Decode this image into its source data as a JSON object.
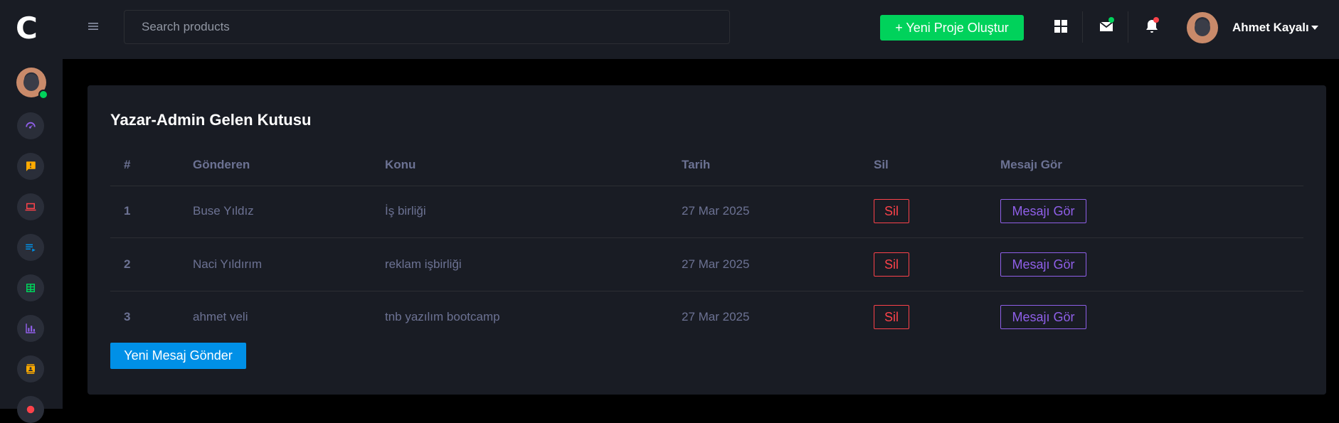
{
  "app": {
    "logo": "C"
  },
  "search": {
    "placeholder": "Search products"
  },
  "header": {
    "create_button": "+ Yeni Proje Oluştur",
    "user_name": "Ahmet Kayalı"
  },
  "sidebar": {
    "icons": [
      {
        "name": "speedometer-icon",
        "color": "#8f5fe8"
      },
      {
        "name": "feedback-icon",
        "color": "#ffab00"
      },
      {
        "name": "laptop-icon",
        "color": "#fc424a"
      },
      {
        "name": "playlist-icon",
        "color": "#0090e7"
      },
      {
        "name": "table-icon",
        "color": "#00d25b"
      },
      {
        "name": "chart-bar-icon",
        "color": "#8f5fe8"
      },
      {
        "name": "contacts-icon",
        "color": "#ffab00"
      }
    ]
  },
  "card": {
    "title": "Yazar-Admin Gelen Kutusu",
    "columns": [
      "#",
      "Gönderen",
      "Konu",
      "Tarih",
      "Sil",
      "Mesajı Gör"
    ],
    "rows": [
      {
        "num": "1",
        "sender": "Buse Yıldız",
        "subject": "İş birliği",
        "date": "27 Mar 2025",
        "delete": "Sil",
        "view": "Mesajı Gör"
      },
      {
        "num": "2",
        "sender": "Naci Yıldırım",
        "subject": "reklam işbirliği",
        "date": "27 Mar 2025",
        "delete": "Sil",
        "view": "Mesajı Gör"
      },
      {
        "num": "3",
        "sender": "ahmet veli",
        "subject": "tnb yazılım bootcamp",
        "date": "27 Mar 2025",
        "delete": "Sil",
        "view": "Mesajı Gör"
      }
    ],
    "new_message_button": "Yeni Mesaj Gönder"
  },
  "colors": {
    "success": "#00d25b",
    "danger": "#fc424a",
    "primary": "#0090e7",
    "purple": "#8f5fe8",
    "background": "#191c24"
  }
}
